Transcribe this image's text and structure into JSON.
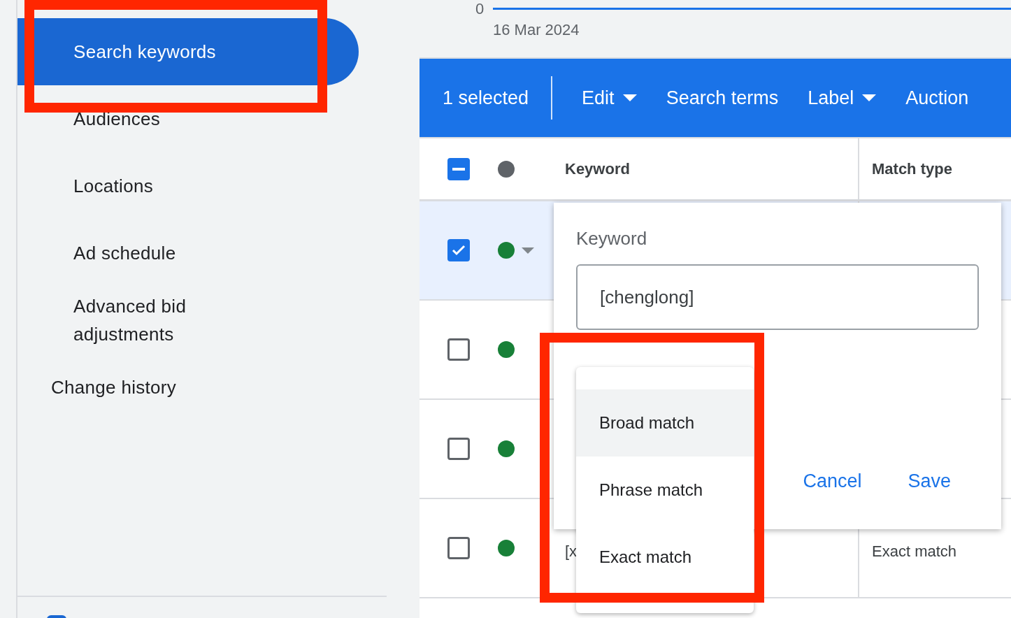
{
  "sidebar": {
    "items": [
      {
        "label": "Search keywords",
        "kind": "sub",
        "selected": true
      },
      {
        "label": "Audiences",
        "kind": "sub",
        "selected": false
      },
      {
        "label": "Locations",
        "kind": "sub",
        "selected": false
      },
      {
        "label": "Ad schedule",
        "kind": "sub",
        "selected": false
      },
      {
        "label": "Advanced bid adjustments",
        "kind": "sub",
        "selected": false
      },
      {
        "label": "Change history",
        "kind": "top",
        "selected": false
      }
    ]
  },
  "chart": {
    "y_tick": "0",
    "x_label": "16 Mar 2024"
  },
  "toolbar": {
    "selection": "1 selected",
    "actions": [
      {
        "label": "Edit",
        "kind": "menu"
      },
      {
        "label": "Search terms",
        "kind": "plain"
      },
      {
        "label": "Label",
        "kind": "menu"
      },
      {
        "label": "Auction",
        "kind": "plain"
      }
    ]
  },
  "table": {
    "columns": [
      "Keyword",
      "Match type"
    ],
    "header_partial": true,
    "rows": [
      {
        "checked": true
      },
      {
        "checked": false
      },
      {
        "checked": false
      },
      {
        "checked": false,
        "keyword": "[x",
        "match_type": "Exact match"
      }
    ]
  },
  "editor": {
    "label": "Keyword",
    "value": "[chenglong]",
    "buttons": [
      "Cancel",
      "Save"
    ]
  },
  "match_menu": {
    "items": [
      {
        "label": "Broad match",
        "selected": true
      },
      {
        "label": "Phrase match",
        "selected": false
      },
      {
        "label": "Exact match",
        "selected": false
      }
    ]
  }
}
